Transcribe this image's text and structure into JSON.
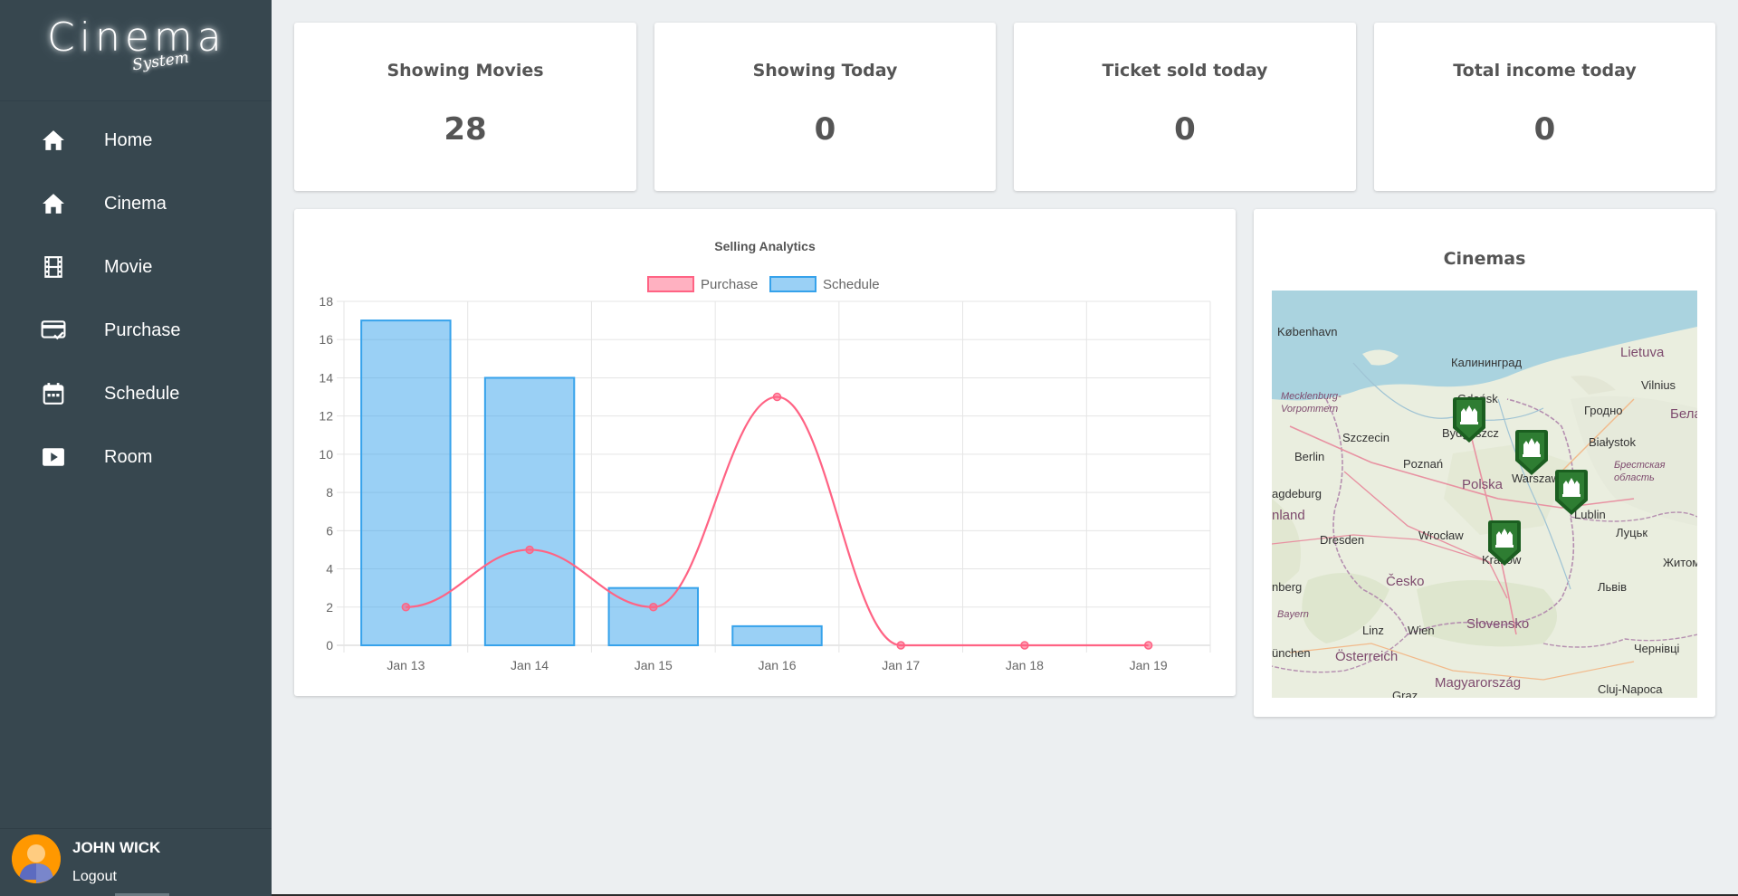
{
  "sidebar": {
    "logo_main": "Cinema",
    "logo_sub": "System",
    "items": [
      {
        "label": "Home",
        "icon": "home-icon"
      },
      {
        "label": "Cinema",
        "icon": "home-icon"
      },
      {
        "label": "Movie",
        "icon": "film-icon"
      },
      {
        "label": "Purchase",
        "icon": "credit-card-check-icon"
      },
      {
        "label": "Schedule",
        "icon": "calendar-icon"
      },
      {
        "label": "Room",
        "icon": "play-video-icon"
      }
    ],
    "user": {
      "name": "JOHN WICK",
      "logout": "Logout"
    }
  },
  "stats": [
    {
      "title": "Showing Movies",
      "value": "28"
    },
    {
      "title": "Showing Today",
      "value": "0"
    },
    {
      "title": "Ticket sold today",
      "value": "0"
    },
    {
      "title": "Total income today",
      "value": "0"
    }
  ],
  "map_panel": {
    "title": "Cinemas",
    "labels": [
      "København",
      "Калининград",
      "Lietuva",
      "Vilnius",
      "Mecklenburg-Vorpommern",
      "Gdańsk",
      "Гродно",
      "Szczecin",
      "Bydgoszcz",
      "Белар",
      "Berlin",
      "Białystok",
      "Poznań",
      "Polska",
      "Warszawa",
      "Брестская область",
      "agdeburg",
      "nland",
      "Lublin",
      "Dresden",
      "Wrocław",
      "Луцьк",
      "Житом",
      "Kraków",
      "Česko",
      "Львів",
      "nberg",
      "Bayern",
      "Linz",
      "Wien",
      "Slovensko",
      "ünchen",
      "Österreich",
      "Чернівці",
      "Magyarország",
      "Cluj-Napoca",
      "Graz"
    ],
    "pin_icon": "cinema-marker-icon"
  },
  "chart_data": {
    "type": "bar",
    "title": "Selling Analytics",
    "categories": [
      "Jan 13",
      "Jan 14",
      "Jan 15",
      "Jan 16",
      "Jan 17",
      "Jan 18",
      "Jan 19"
    ],
    "series": [
      {
        "name": "Purchase",
        "type": "line",
        "values": [
          2,
          5,
          2,
          13,
          0,
          0,
          0
        ],
        "color": "#ff6384"
      },
      {
        "name": "Schedule",
        "type": "bar",
        "values": [
          17,
          14,
          3,
          1,
          0,
          0,
          0
        ],
        "color": "#36a2eb"
      }
    ],
    "yticks": [
      "0",
      "2",
      "4",
      "6",
      "8",
      "10",
      "12",
      "14",
      "16",
      "18"
    ],
    "ylim": [
      0,
      18
    ],
    "grid": true,
    "legend": "top"
  }
}
